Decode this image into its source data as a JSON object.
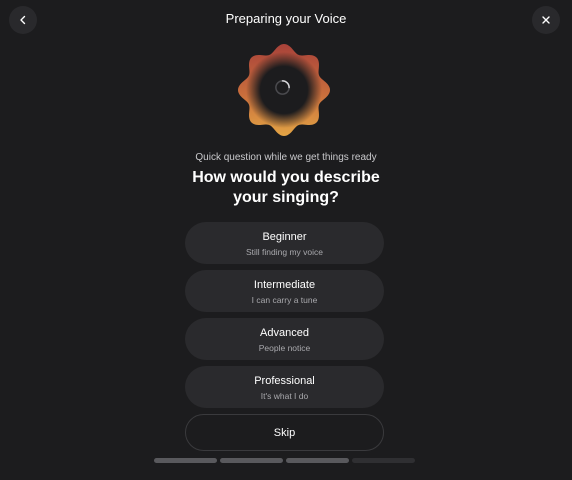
{
  "header": {
    "title": "Preparing your Voice",
    "back_icon": "chevron-left-icon",
    "close_icon": "close-icon"
  },
  "badge": {
    "icon": "scalloped-badge-icon",
    "spinner_icon": "loading-spinner-icon",
    "colors": {
      "outer_top": "#a8423a",
      "outer_bottom": "#e3a445",
      "inner": "#1c1c1e"
    }
  },
  "prompt": {
    "subtitle": "Quick question while we get things ready",
    "question_line1": "How would you describe",
    "question_line2": "your singing?"
  },
  "options": [
    {
      "label": "Beginner",
      "description": "Still finding my voice"
    },
    {
      "label": "Intermediate",
      "description": "I can carry a tune"
    },
    {
      "label": "Advanced",
      "description": "People notice"
    },
    {
      "label": "Professional",
      "description": "It's what I do"
    }
  ],
  "skip": {
    "label": "Skip"
  },
  "progress": {
    "total_steps": 4,
    "completed_steps": 3
  },
  "colors": {
    "background": "#1c1c1e",
    "card": "#2a2a2d",
    "text": "#ffffff",
    "muted": "#a9a9ad"
  }
}
